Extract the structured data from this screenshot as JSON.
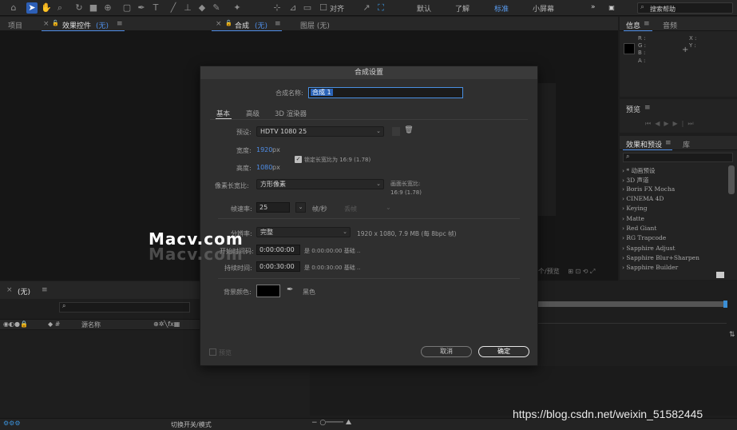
{
  "toolbar": {
    "workspaces": [
      "默认",
      "了解",
      "标准",
      "小屏幕"
    ],
    "active_workspace": "标准",
    "align_label": "对齐",
    "search_placeholder": "搜索帮助",
    "more": "»"
  },
  "panels": {
    "project_tab": "项目",
    "effect_controls_tab": "效果控件",
    "effect_controls_suffix": "(无)",
    "comp_tab": "合成",
    "comp_suffix": "(无)",
    "layer_tab": "图层 (无)",
    "menu_glyph": "≡",
    "close_glyph": "×",
    "lock_glyph": "🔓",
    "timeline_tab": "(无)",
    "timeline_col_source": "源名称",
    "timeline_bottom": "切换开关/模式",
    "comp_footer": "个/预览"
  },
  "info_panel": {
    "tab_info": "信息",
    "tab_audio": "音频",
    "r": "R :",
    "g": "G :",
    "b": "B :",
    "a": "A :",
    "x": "X :",
    "y": "Y :"
  },
  "preview_panel": {
    "title": "预览"
  },
  "effects_panel": {
    "tab": "效果和预设",
    "tab_lib": "库",
    "items": [
      "› * 动画预设",
      "› 3D 声道",
      "› Boris FX Mocha",
      "› CINEMA 4D",
      "› Keying",
      "› Matte",
      "› Red Giant",
      "› RG Trapcode",
      "› Sapphire Adjust",
      "› Sapphire Blur+Sharpen",
      "› Sapphire Builder"
    ]
  },
  "dialog": {
    "title": "合成设置",
    "name_label": "合成名称:",
    "name_value": "合成 1",
    "tabs": [
      "基本",
      "高级",
      "3D 渲染器"
    ],
    "active_tab": "基本",
    "preset_label": "预设:",
    "preset_value": "HDTV 1080 25",
    "width_label": "宽度:",
    "width_value": "1920",
    "height_label": "高度:",
    "height_value": "1080",
    "px": "px",
    "lock_label": "锁定长宽比为 16:9 (1.78)",
    "par_label": "像素长宽比:",
    "par_value": "方形像素",
    "frame_aspect_label": "画面长宽比:",
    "frame_aspect_value": "16:9 (1.78)",
    "fps_label": "帧速率:",
    "fps_value": "25",
    "fps_unit": "帧/秒",
    "drop_frame": "丢帧",
    "resolution_label": "分辨率:",
    "resolution_value": "完整",
    "resolution_info": "1920 x 1080, 7.9 MB (每 8bpc 帧)",
    "start_label": "开始时间码:",
    "start_value": "0:00:00:00",
    "start_info": "是 0:00:00:00  基础 ..",
    "duration_label": "持续时间:",
    "duration_value": "0:00:30:00",
    "duration_info": "是 0:00:30:00  基础 ..",
    "bg_label": "背景颜色:",
    "bg_color": "#000000",
    "bg_name": "黑色",
    "preview_label": "预览",
    "cancel": "取消",
    "ok": "确定"
  },
  "watermark": "Macv.com",
  "url_watermark": "https://blog.csdn.net/weixin_51582445",
  "colors": {
    "accent": "#4f8ee8",
    "active_tool": "#2d5fb6"
  }
}
